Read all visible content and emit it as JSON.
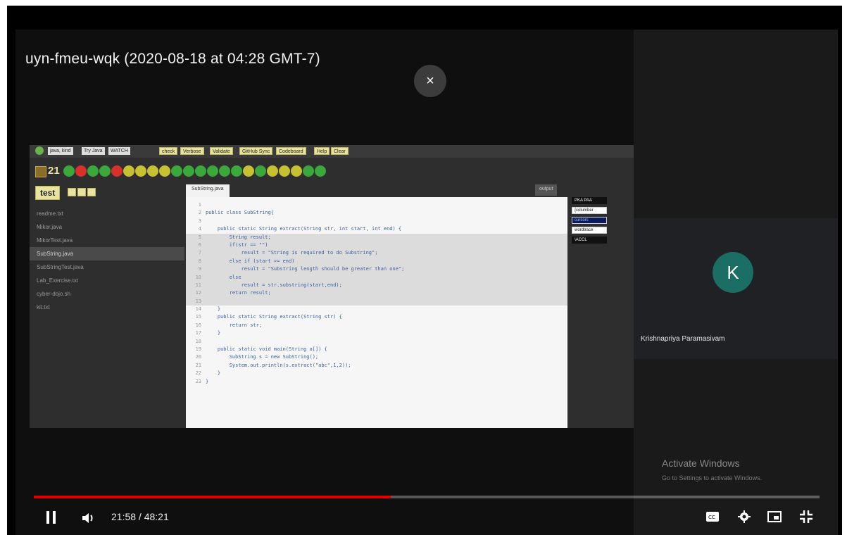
{
  "video": {
    "title": "uyn-fmeu-wqk (2020-08-18 at 04:28 GMT-7)",
    "close_label": "×"
  },
  "ide": {
    "file_tabs": [
      "java, kind",
      "Try Java",
      "WATCH"
    ],
    "toolbar_buttons": [
      "check",
      "Verbose",
      "Validate",
      "GitHub Sync",
      "Codeboard",
      "Help",
      "Clear"
    ],
    "counter": "21",
    "test_label": "test",
    "dots": [
      "#3aa83a",
      "#d9302c",
      "#3aa83a",
      "#3aa83a",
      "#d9302c",
      "#c7c030",
      "#c7c030",
      "#c7c030",
      "#c7c030",
      "#3aa83a",
      "#3aa83a",
      "#3aa83a",
      "#3aa83a",
      "#3aa83a",
      "#3aa83a",
      "#c7c030",
      "#3aa83a",
      "#c7c030",
      "#c7c030",
      "#c7c030",
      "#3aa83a",
      "#3aa83a"
    ],
    "files": [
      "readme.txt",
      "Mikor.java",
      "MikorTest.java",
      "SubString.java",
      "SubStringTest.java",
      "Lab_Exercise.txt",
      "cyber-dojo.sh",
      "kit.txt"
    ],
    "active_file_index": 3,
    "editor_tab": "SubString.java",
    "output_tab": "output",
    "code": [
      {
        "n": "1",
        "t": "",
        "hl": false
      },
      {
        "n": "2",
        "t": "public class SubString{",
        "hl": false
      },
      {
        "n": "3",
        "t": "",
        "hl": false
      },
      {
        "n": "4",
        "t": "    public static String extract(String str, int start, int end) {",
        "hl": false
      },
      {
        "n": "5",
        "t": "        String result;",
        "hl": true
      },
      {
        "n": "6",
        "t": "        if(str == \"\")",
        "hl": true
      },
      {
        "n": "7",
        "t": "            result = \"String is required to do Substring\";",
        "hl": true
      },
      {
        "n": "8",
        "t": "        else if (start >= end)",
        "hl": true
      },
      {
        "n": "9",
        "t": "            result = \"Substring length should be greater than one\";",
        "hl": true
      },
      {
        "n": "10",
        "t": "        else",
        "hl": true
      },
      {
        "n": "11",
        "t": "            result = str.substring(start,end);",
        "hl": true
      },
      {
        "n": "12",
        "t": "        return result;",
        "hl": true
      },
      {
        "n": "13",
        "t": "",
        "hl": true
      },
      {
        "n": "14",
        "t": "    }",
        "hl": false
      },
      {
        "n": "15",
        "t": "    public static String extract(String str) {",
        "hl": false
      },
      {
        "n": "16",
        "t": "        return str;",
        "hl": false
      },
      {
        "n": "17",
        "t": "    }",
        "hl": false
      },
      {
        "n": "18",
        "t": "",
        "hl": false
      },
      {
        "n": "19",
        "t": "    public static void main(String a[]) {",
        "hl": false
      },
      {
        "n": "20",
        "t": "        SubString s = new SubString();",
        "hl": false
      },
      {
        "n": "21",
        "t": "        System.out.println(s.extract(\"abc\",1,2));",
        "hl": false
      },
      {
        "n": "22",
        "t": "    }",
        "hl": false
      },
      {
        "n": "23",
        "t": "}",
        "hl": false
      }
    ],
    "badges": [
      "PKA  PAA",
      "{columber",
      "cursors",
      "wordtrace",
      "\\ACCL"
    ]
  },
  "participant": {
    "initial": "K",
    "name": "Krishnapriya Paramasivam"
  },
  "watermark": {
    "line1": "Activate Windows",
    "line2": "Go to Settings to activate Windows."
  },
  "player": {
    "time": "21:58 / 48:21",
    "progress_fraction": 0.4547,
    "accent": "#e00000"
  }
}
